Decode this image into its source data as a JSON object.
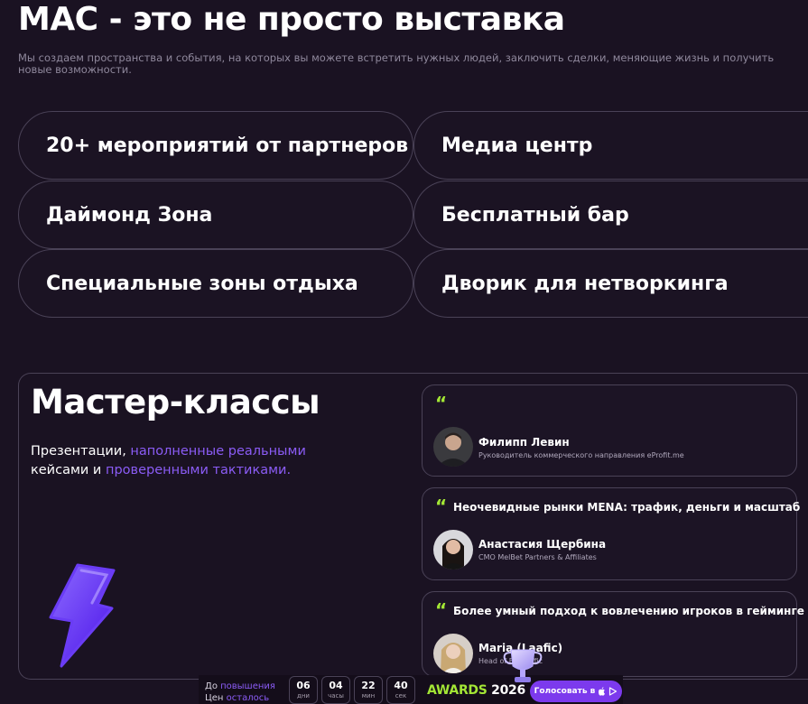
{
  "header": {
    "title": "МАС - это не просто выставка",
    "subtitle": "Мы создаем пространства и события, на которых вы можете встретить нужных людей, заключить сделки, меняющие жизнь и получить новые возможности."
  },
  "features": [
    "20+ мероприятий от партнеров",
    "Медиа центр",
    "Даймонд Зона",
    "Бесплатный бар",
    "Специальные зоны отдыха",
    "Дворик для нетворкинга"
  ],
  "masterclass": {
    "title": "Мастер-классы",
    "desc_part1": "Презентации, ",
    "desc_accent1": "наполненные реальными",
    "desc_part2": "кейсами и ",
    "desc_accent2": "проверенными тактиками."
  },
  "talks": [
    {
      "title": "",
      "speaker": "Филипп Левин",
      "role": "Руководитель коммерческого направления eProfit.me"
    },
    {
      "title": "Неочевидные рынки MENA: трафик, деньги и масштаб",
      "speaker": "Анастасия Щербина",
      "role": "CMO MelBet Partners & Affiliates"
    },
    {
      "title": "Более умный подход к вовлечению игроков в гейминге",
      "speaker": "Maria (Laafic)",
      "role": "Head of Eu... affic"
    }
  ],
  "countdown": {
    "line1_prefix": "До ",
    "line1_accent": "повышения",
    "line2_prefix": "Цен ",
    "line2_accent": "осталось",
    "units": [
      {
        "value": "06",
        "label": "дни"
      },
      {
        "value": "04",
        "label": "часы"
      },
      {
        "value": "22",
        "label": "мин"
      },
      {
        "value": "40",
        "label": "сек"
      }
    ]
  },
  "awards": {
    "word": "AWARDS",
    "year": "2026",
    "vote_label": "Голосовать в"
  },
  "colors": {
    "background": "#1a1222",
    "accent_purple": "#8b5cf6",
    "accent_green": "#a3e635",
    "button": "#7c3aed"
  }
}
